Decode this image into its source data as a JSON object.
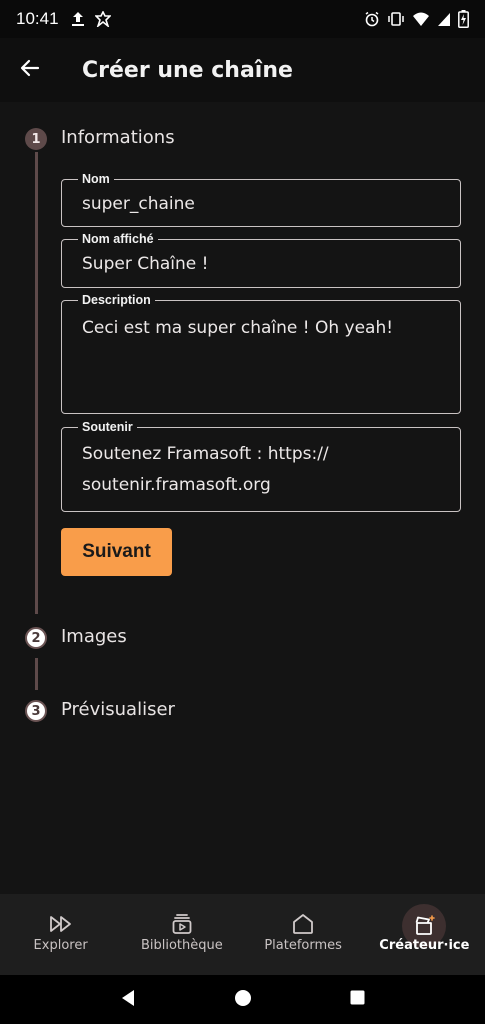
{
  "status_bar": {
    "time": "10:41",
    "left_icons": [
      "upload-icon",
      "app-notification-icon"
    ],
    "right_icons": [
      "alarm-icon",
      "vibrate-icon",
      "wifi-icon",
      "signal-icon",
      "battery-charging-icon"
    ]
  },
  "app_bar": {
    "title": "Créer une chaîne",
    "back_icon": "arrow-left-icon"
  },
  "steps": [
    {
      "number": "1",
      "label": "Informations",
      "active": true
    },
    {
      "number": "2",
      "label": "Images",
      "active": false
    },
    {
      "number": "3",
      "label": "Prévisualiser",
      "active": false
    }
  ],
  "form": {
    "name": {
      "label": "Nom",
      "value": "super_chaine"
    },
    "display_name": {
      "label": "Nom affiché",
      "value": "Super Chaîne !"
    },
    "description": {
      "label": "Description",
      "value": "Ceci est ma super chaîne ! Oh yeah!"
    },
    "support": {
      "label": "Soutenir",
      "value": "Soutenez Framasoft : https://\nsoutenir.framasoft.org"
    },
    "next_label": "Suivant"
  },
  "bottom_nav": {
    "items": [
      {
        "label": "Explorer",
        "icon": "fast-forward-icon",
        "active": false
      },
      {
        "label": "Bibliothèque",
        "icon": "library-icon",
        "active": false
      },
      {
        "label": "Plateformes",
        "icon": "home-icon",
        "active": false
      },
      {
        "label": "Créateur·ice",
        "icon": "clapperboard-icon",
        "active": true
      }
    ]
  },
  "colors": {
    "accent": "#f99d4a",
    "step_active": "#5e4a4a",
    "background": "#141414"
  },
  "system_nav": [
    "back-triangle-icon",
    "home-circle-icon",
    "recents-square-icon"
  ]
}
